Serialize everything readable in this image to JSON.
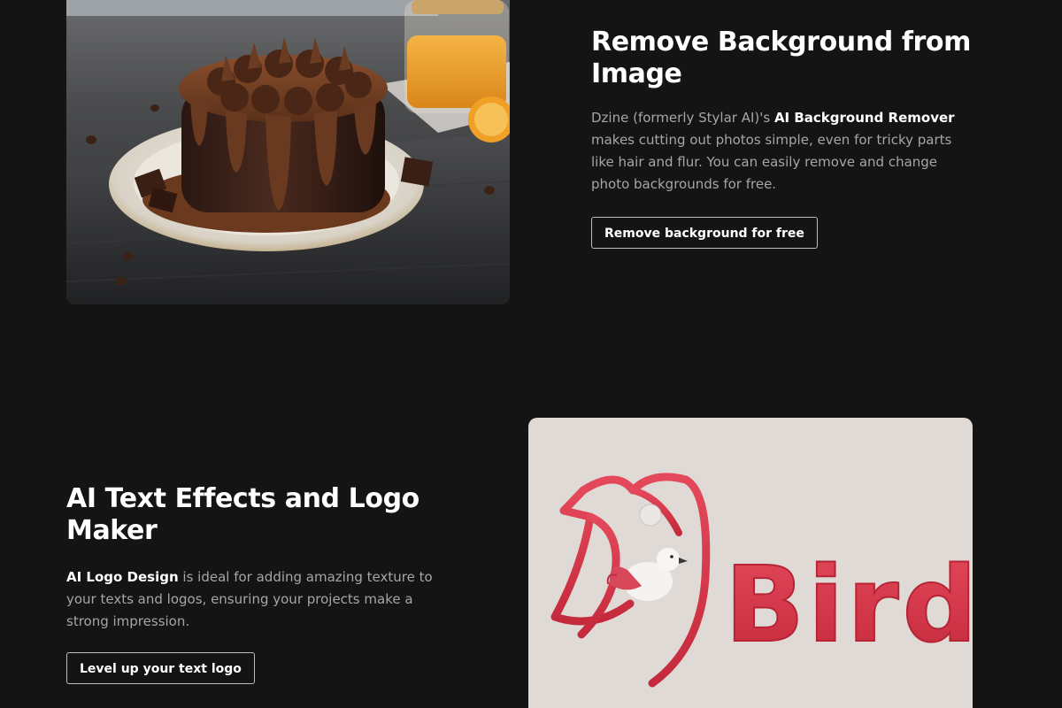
{
  "section_background_remover": {
    "title": "Remove Background from Image",
    "desc_prefix": "Dzine (formerly Stylar AI)'s ",
    "desc_highlight": "AI Background Remover",
    "desc_suffix": " makes cutting out photos simple, even for tricky parts like hair and flur. You can easily remove and change photo backgrounds for free.",
    "button_label": "Remove background for free",
    "image_icon": "chocolate-cake-photo"
  },
  "section_text_effects": {
    "title": "AI Text Effects and Logo Maker",
    "desc_highlight": "AI Logo Design",
    "desc_suffix": " is ideal for adding amazing texture to your texts and logos, ensuring your projects make a strong impression.",
    "button_label": "Level up your text logo",
    "image_icon": "bird-logo-illustration",
    "logo_text": "Bird"
  },
  "colors": {
    "background": "#141414",
    "heading": "#ffffff",
    "body_text": "#a6a6a6",
    "button_border": "#bdbdbd",
    "logo_red": "#d8364a",
    "logo_card_bg": "#e0dad6"
  }
}
